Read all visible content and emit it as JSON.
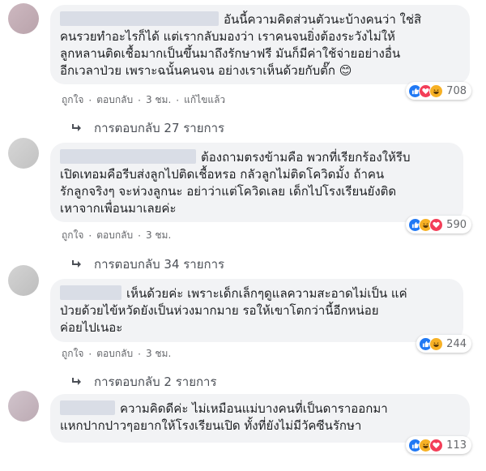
{
  "colors": {
    "like": "#2078f4",
    "love": "#f33e58",
    "haha": "#f7b125",
    "bubble": "#f2f3f5",
    "meta": "#65676b"
  },
  "comments": [
    {
      "text_lines": [
        "อันนี้ความคิดส่วนตัวนะบ้างคนว่า ใช่สิ",
        "คนรวยทำอะไรก็ได้ แต่เรากลับมองว่า เราคนจนยิ่งต้องระวังไม่ให้",
        "ลูกหลานติดเชื้อมากเป็นขึ้นมาถึงรักษาฟรี มันก็มีค่าใช้จ่ายอย่างอื่น",
        "อีกเวลาป่วย เพราะฉนั้นคนจน อย่างเราเห็นด้วยกับตั๊ก 😊"
      ],
      "reaction_icons": [
        "like-icon",
        "love-icon",
        "haha-icon"
      ],
      "reaction_count": "708",
      "like_label": "ถูกใจ",
      "reply_label": "ตอบกลับ",
      "time": "3 ชม.",
      "edited": "แก้ไขแล้ว",
      "replies_label": "การตอบกลับ 27 รายการ"
    },
    {
      "text_lines": [
        "ต้องถามตรงข้ามคือ พวกที่เรียกร้องให้รีบ",
        "เปิดเทอมคือรีบส่งลูกไปติดเชื้อหรอ กลัวลูกไม่ติดโควิดมั้ง ถ้าคน",
        "รักลูกจริงๆ จะห่วงลูกนะ อย่าว่าแต่โควิดเลย เด็กไปโรงเรียนยังติด",
        "เหาจากเพื่อนมาเลยค่ะ"
      ],
      "reaction_icons": [
        "like-icon",
        "haha-icon",
        "love-icon"
      ],
      "reaction_count": "590",
      "like_label": "ถูกใจ",
      "reply_label": "ตอบกลับ",
      "time": "3 ชม.",
      "replies_label": "การตอบกลับ 34 รายการ"
    },
    {
      "text_lines": [
        "เห็นด้วยค่ะ เพราะเด็กเล็กๆดูแลความสะอาดไม่เป็น แค่",
        "ป่วยด้วยไข้หวัดยังเป็นห่วงมากมาย รอให้เขาโตกว่านี้อีกหน่อย",
        "ค่อยไปเนอะ"
      ],
      "reaction_icons": [
        "like-icon",
        "haha-icon"
      ],
      "reaction_count": "244",
      "like_label": "ถูกใจ",
      "reply_label": "ตอบกลับ",
      "time": "3 ชม.",
      "replies_label": "การตอบกลับ 2 รายการ"
    },
    {
      "text_lines": [
        "ความคิดดีค่ะ ไม่เหมือนแม่บางคนที่เป็นดาราออกมา",
        "แหกปากปาวๆอยากให้โรงเรียนเปิด ทั้งที่ยังไม่มีวัคซีนรักษา"
      ],
      "reaction_icons": [
        "like-icon",
        "haha-icon",
        "love-icon"
      ],
      "reaction_count": "113"
    }
  ]
}
